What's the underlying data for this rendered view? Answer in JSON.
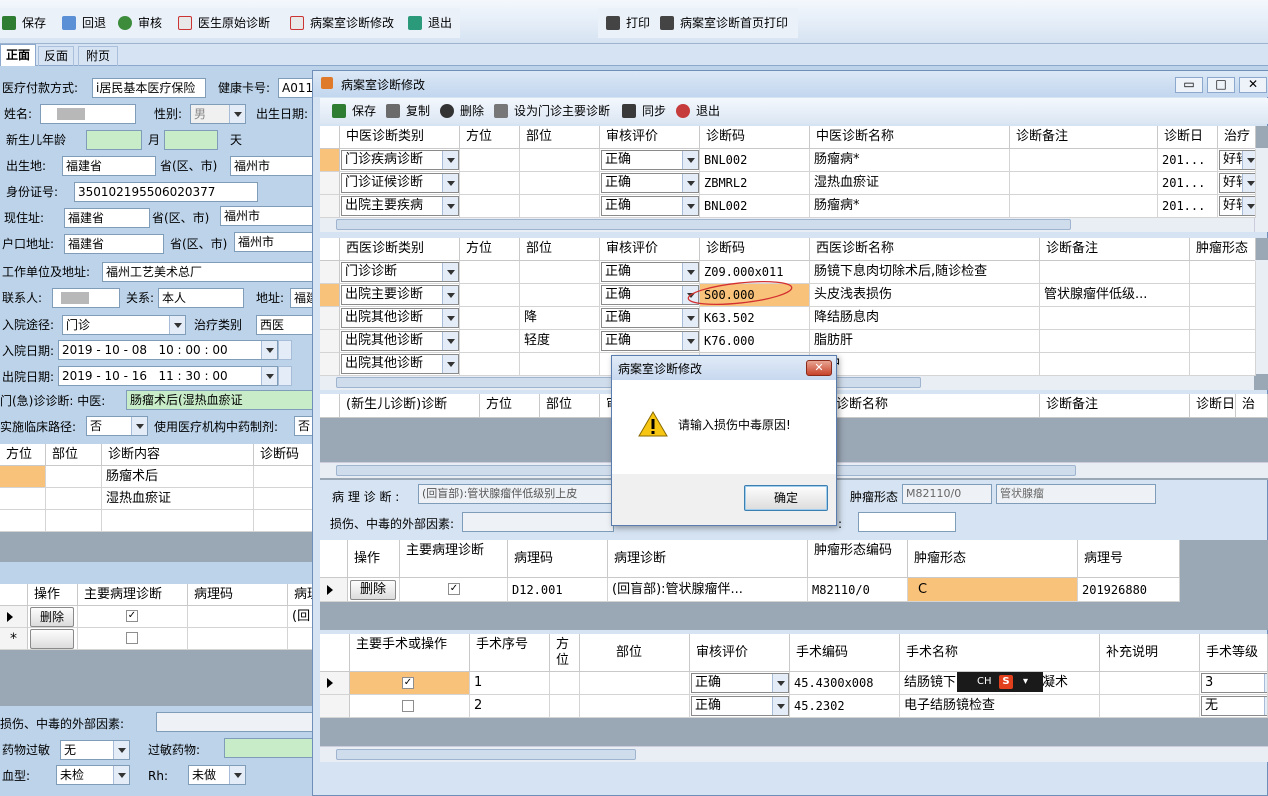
{
  "toolbar": {
    "save": "保存",
    "back": "回退",
    "review": "审核",
    "doctor_diag": "医生原始诊断",
    "ward_diag_edit": "病案室诊断修改",
    "exit": "退出",
    "print": "打印",
    "front_print": "病案室诊断首页打印"
  },
  "tabs": {
    "front": "正面",
    "back": "反面",
    "appendix": "附页"
  },
  "form": {
    "pay_label": "医疗付款方式:",
    "pay_value": "i居民基本医疗保险",
    "card_label": "健康卡号:",
    "card_value": "A011",
    "name_label": "姓名:",
    "sex_label": "性别:",
    "sex_value": "男",
    "birth_label": "出生日期:",
    "newborn_label": "新生儿年龄",
    "month_label": "月",
    "day_label": "天",
    "birthplace_label": "出生地:",
    "birthplace_prov": "福建省",
    "prov_city_label": "省(区、市)",
    "birthplace_city": "福州市",
    "id_label": "身份证号:",
    "id_value": "350102195506020377",
    "addr_label": "现住址:",
    "addr_prov": "福建省",
    "addr_city": "福州市",
    "hukou_label": "户口地址:",
    "hukou_prov": "福建省",
    "hukou_city": "福州市",
    "work_label": "工作单位及地址:",
    "work_value": "福州工艺美术总厂",
    "contact_label": "联系人:",
    "relation_label": "关系:",
    "relation_value": "本人",
    "address2_label": "地址:",
    "address2_value": "福建",
    "admit_route_label": "入院途径:",
    "admit_route_value": "门诊",
    "treat_label": "治疗类别",
    "treat_value": "西医",
    "admit_date_label": "入院日期:",
    "admit_date_value": "2019 - 10 - 08   10 : 00 : 00",
    "disc_date_label": "出院日期:",
    "disc_date_value": "2019 - 10 - 16   11 : 30 : 00",
    "clinic_label": "门(急)诊诊断: 中医:",
    "clinic_value": "肠瘤术后(湿热血瘀证",
    "path_label": "实施临床路径:",
    "path_value": "否",
    "med_label": "使用医疗机构中药制剂:",
    "med_value": "否"
  },
  "left_grid1": {
    "headers": [
      "方位",
      "部位",
      "诊断内容",
      "诊断码"
    ],
    "rows": [
      [
        "",
        "",
        "肠瘤术后",
        ""
      ],
      [
        "",
        "",
        "湿热血瘀证",
        ""
      ]
    ]
  },
  "left_grid2": {
    "headers": [
      "操作",
      "主要病理诊断",
      "病理码",
      "病理"
    ],
    "delete": "删除",
    "row1_extra": "(回"
  },
  "left_bottom": {
    "injury_label": "损伤、中毒的外部因素:",
    "allergy_label": "药物过敏",
    "allergy_value": "无",
    "allergy_drug_label": "过敏药物:",
    "blood_label": "血型:",
    "blood_value": "未检",
    "rh_label": "Rh:",
    "rh_value": "未做"
  },
  "dialog": {
    "title": "病案室诊断修改",
    "toolbar": {
      "save": "保存",
      "copy": "复制",
      "delete": "删除",
      "set_main": "设为门诊主要诊断",
      "sync": "同步",
      "exit": "退出"
    },
    "tcm": {
      "headers": [
        "中医诊断类别",
        "方位",
        "部位",
        "审核评价",
        "诊断码",
        "中医诊断名称",
        "诊断备注",
        "诊断日",
        "治疗"
      ],
      "rows": [
        [
          "门诊疾病诊断",
          "",
          "",
          "正确",
          "BNL002",
          "肠瘤病*",
          "",
          "201...",
          "好转"
        ],
        [
          "门诊证候诊断",
          "",
          "",
          "正确",
          "ZBMRL2",
          "湿热血瘀证",
          "",
          "201...",
          "好转"
        ],
        [
          "出院主要疾病",
          "",
          "",
          "正确",
          "BNL002",
          "肠瘤病*",
          "",
          "201...",
          "好转"
        ]
      ]
    },
    "wm": {
      "headers": [
        "西医诊断类别",
        "方位",
        "部位",
        "审核评价",
        "诊断码",
        "西医诊断名称",
        "诊断备注",
        "肿瘤形态"
      ],
      "rows": [
        [
          "门诊诊断",
          "",
          "",
          "正确",
          "Z09.000x011",
          "肠镜下息肉切除术后,随诊检查",
          "",
          ""
        ],
        [
          "出院主要诊断",
          "",
          "",
          "正确",
          "S00.000",
          "头皮浅表损伤",
          "管状腺瘤伴低级...",
          ""
        ],
        [
          "出院其他诊断",
          "",
          "降",
          "正确",
          "K63.502",
          "降结肠息肉",
          "",
          ""
        ],
        [
          "出院其他诊断",
          "",
          "轻度",
          "正确",
          "K76.000",
          "脂肪肝",
          "",
          ""
        ],
        [
          "出院其他诊断",
          "",
          "",
          "",
          "",
          "瘤肿",
          "",
          ""
        ]
      ]
    },
    "newborn": {
      "headers": [
        "(新生儿诊断)诊断",
        "方位",
        "部位",
        "审",
        "诊断名称",
        "诊断备注",
        "诊断日",
        "治"
      ]
    },
    "patho": {
      "label": "病 理 诊 断 :",
      "value": "(回盲部):管状腺瘤伴低级别上皮",
      "tumor_label": "肿瘤形态",
      "tumor_code": "M82110/0",
      "tumor_name": "管状腺瘤",
      "injury_label": "损伤、中毒的外部因素:"
    },
    "patho_grid": {
      "headers": [
        "操作",
        "主要病理诊断",
        "病理码",
        "病理诊断",
        "肿瘤形态编码",
        "肿瘤形态",
        "病理号"
      ],
      "rows": [
        [
          "删除",
          "checked",
          "D12.001",
          "(回盲部):管状腺瘤伴...",
          "M82110/0",
          "C",
          "201926880"
        ]
      ]
    },
    "op_grid": {
      "headers": [
        "主要手术或操作",
        "手术序号",
        "方位",
        "部位",
        "审核评价",
        "手术编码",
        "手术名称",
        "补充说明",
        "手术等级"
      ],
      "rows": [
        [
          "checked",
          "1",
          "",
          "",
          "正确",
          "45.4300x008",
          "结肠镜下",
          "凝术",
          "3"
        ],
        [
          "",
          "2",
          "",
          "",
          "正确",
          "45.2302",
          "电子结肠镜检查",
          "",
          "无"
        ]
      ]
    }
  },
  "alert": {
    "title": "病案室诊断修改",
    "message": "请输入损伤中毒原因!",
    "ok": "确定"
  },
  "ime": {
    "label": "CH",
    "logo": "S"
  }
}
